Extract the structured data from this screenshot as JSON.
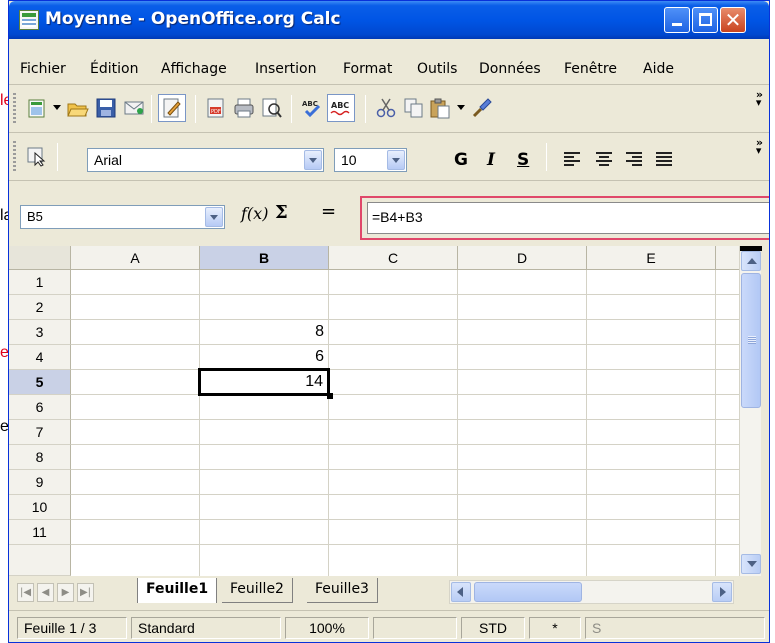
{
  "window": {
    "title": "Moyenne - OpenOffice.org Calc"
  },
  "background_fragments": [
    "le",
    "la",
    "es",
    "es"
  ],
  "menu": {
    "items": [
      "Fichier",
      "Édition",
      "Affichage",
      "Insertion",
      "Format",
      "Outils",
      "Données",
      "Fenêtre",
      "Aide"
    ]
  },
  "standard_toolbar": {
    "icons": [
      "new-document-icon",
      "open-folder-icon",
      "save-disk-icon",
      "email-icon",
      "edit-mode-icon",
      "export-pdf-icon",
      "print-icon",
      "page-preview-icon",
      "spellcheck-icon",
      "autospellcheck-icon",
      "cut-icon",
      "copy-icon",
      "paste-icon",
      "clone-format-brush-icon"
    ],
    "overflow": "»"
  },
  "format_toolbar": {
    "font_name": "Arial",
    "font_size": "10",
    "bold": "G",
    "italic": "I",
    "underline": "S",
    "overflow": "»"
  },
  "formula_bar": {
    "name_box": "B5",
    "function_wizard": "f(x)",
    "sum": "Σ",
    "equals": "=",
    "formula": "=B4+B3"
  },
  "grid": {
    "columns": [
      "A",
      "B",
      "C",
      "D",
      "E"
    ],
    "rows": [
      "1",
      "2",
      "3",
      "4",
      "5",
      "6",
      "7",
      "8",
      "9",
      "10",
      "11"
    ],
    "active_column": "B",
    "active_row": "5",
    "cells": [
      {
        "ref": "B3",
        "value": "8"
      },
      {
        "ref": "B4",
        "value": "6"
      },
      {
        "ref": "B5",
        "value": "14"
      }
    ]
  },
  "sheet_tabs": {
    "tabs": [
      "Feuille1",
      "Feuille2",
      "Feuille3"
    ],
    "active": "Feuille1"
  },
  "status_bar": {
    "sheet": "Feuille 1 / 3",
    "page_style": "Standard",
    "zoom": "100%",
    "insert_mode": "",
    "selection_mode": "STD",
    "modified": "*",
    "sum_field": "S"
  }
}
